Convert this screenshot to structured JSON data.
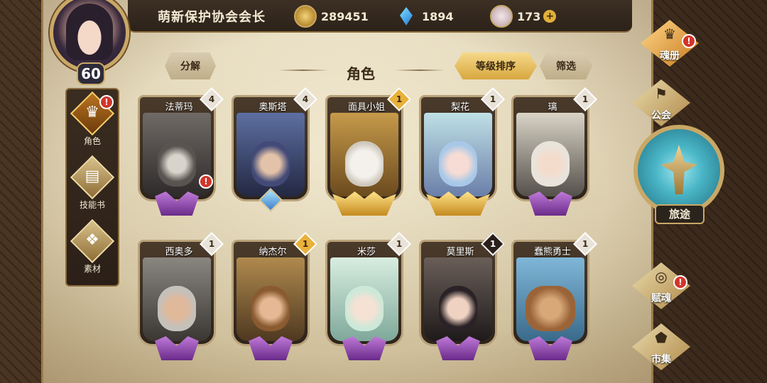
{
  "player": {
    "name": "萌新保护协会会长",
    "level": "60"
  },
  "currencies": [
    {
      "icon": "gold-coin-icon",
      "value": "289451"
    },
    {
      "icon": "blue-crystal-icon",
      "value": "1894"
    },
    {
      "icon": "soul-shard-icon",
      "value": "173"
    }
  ],
  "left_nav": [
    {
      "label": "角色",
      "icon": "character-icon",
      "active": true,
      "alert": true
    },
    {
      "label": "技能书",
      "icon": "skill-book-icon",
      "active": false,
      "alert": false
    },
    {
      "label": "素材",
      "icon": "material-icon",
      "active": false,
      "alert": false
    }
  ],
  "header": {
    "decompose_label": "分解",
    "title": "角色",
    "sort_label": "等级排序",
    "filter_label": "筛选"
  },
  "cards": [
    {
      "name": "法蒂玛",
      "stars": "4",
      "star_style": "white",
      "rank": "purple",
      "alert": true
    },
    {
      "name": "奥斯塔",
      "stars": "4",
      "star_style": "white",
      "rank": "blue",
      "alert": false
    },
    {
      "name": "面具小姐",
      "stars": "1",
      "star_style": "gold",
      "rank": "gold",
      "alert": false
    },
    {
      "name": "梨花",
      "stars": "1",
      "star_style": "white",
      "rank": "gold",
      "alert": false
    },
    {
      "name": "璃",
      "stars": "1",
      "star_style": "white",
      "rank": "purple",
      "alert": false
    },
    {
      "name": "西奥多",
      "stars": "1",
      "star_style": "white",
      "rank": "purple",
      "alert": false
    },
    {
      "name": "纳杰尔",
      "stars": "1",
      "star_style": "gold",
      "rank": "purple",
      "alert": false
    },
    {
      "name": "米莎",
      "stars": "1",
      "star_style": "white",
      "rank": "purple",
      "alert": false
    },
    {
      "name": "莫里斯",
      "stars": "1",
      "star_style": "dark",
      "rank": "purple",
      "alert": false
    },
    {
      "name": "蠢熊勇士",
      "stars": "1",
      "star_style": "white",
      "rank": "purple",
      "alert": false
    }
  ],
  "right_nav": {
    "soul_book": "魂册",
    "guild": "公会",
    "journey": "旅途",
    "endow_soul": "赋魂",
    "market": "市集"
  },
  "alert_mark": "!",
  "plus_mark": "+"
}
